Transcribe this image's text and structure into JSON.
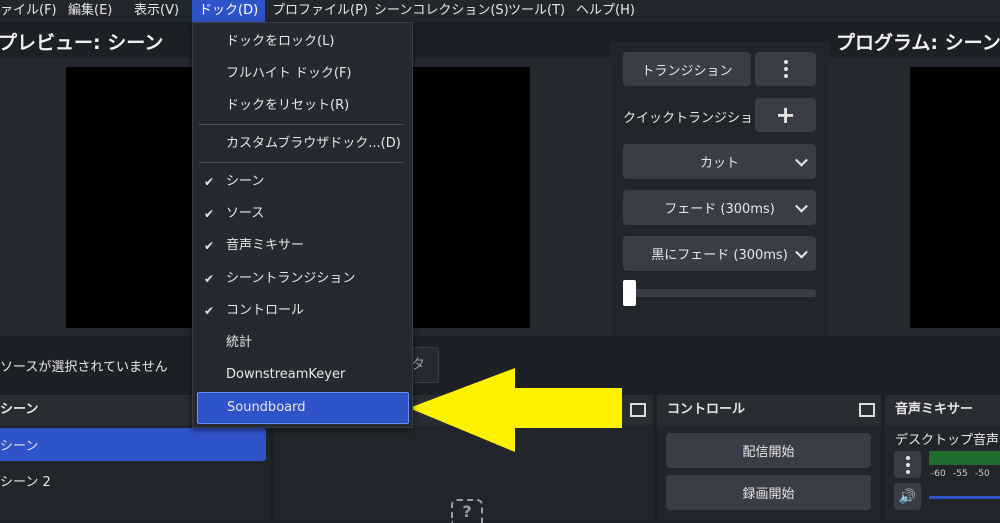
{
  "menubar": {
    "items": [
      "ァイル(F)",
      "編集(E)",
      "表示(V)",
      "ドック(D)",
      "プロファイル(P)",
      "シーンコレクション(S)",
      "ツール(T)",
      "ヘルプ(H)"
    ]
  },
  "preview": {
    "title": "プレビュー: シーン"
  },
  "program": {
    "title": "プログラム: シーン"
  },
  "transition_panel": {
    "transition_button": "トランジション",
    "quick_transition_label": "クイックトランジション",
    "options": [
      "カット",
      "フェード (300ms)",
      "黒にフェード (300ms)"
    ],
    "slider_value": 0
  },
  "status": {
    "no_source_text": "ソースが選択されていません",
    "filter_button_partial": "タ"
  },
  "scenes_dock": {
    "title": "シーン",
    "items": [
      "シーン",
      "シーン 2"
    ],
    "selected_index": 0
  },
  "controls_dock": {
    "title": "コントロール",
    "buttons": [
      "配信開始",
      "録画開始"
    ]
  },
  "mixer_dock": {
    "title": "音声ミキサー",
    "channel_name": "デスクトップ音声",
    "scale": [
      "-60",
      "-55",
      "-50"
    ]
  },
  "dock_menu": {
    "items": [
      {
        "label": "ドックをロック(L)",
        "checked": false
      },
      {
        "label": "フルハイト ドック(F)",
        "checked": false
      },
      {
        "label": "ドックをリセット(R)",
        "checked": false
      },
      {
        "label": "カスタムブラウザドック...(D)",
        "checked": false
      },
      {
        "label": "シーン",
        "checked": true
      },
      {
        "label": "ソース",
        "checked": true
      },
      {
        "label": "音声ミキサー",
        "checked": true
      },
      {
        "label": "シーントランジション",
        "checked": true
      },
      {
        "label": "コントロール",
        "checked": true
      },
      {
        "label": "統計",
        "checked": false
      },
      {
        "label": "DownstreamKeyer",
        "checked": false
      },
      {
        "label": "Soundboard",
        "checked": false,
        "highlighted": true
      }
    ]
  },
  "check_glyph": "✔",
  "colors": {
    "accent": "#2f53c9",
    "arrow": "#fff200",
    "meter": "#1f6e2e"
  }
}
